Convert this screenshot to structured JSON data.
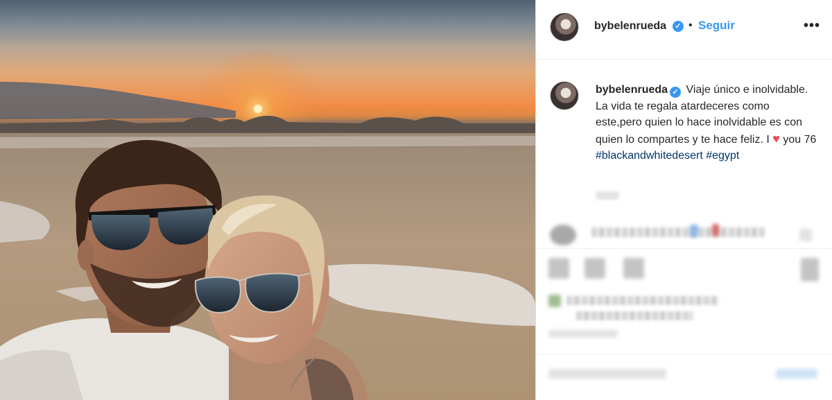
{
  "post": {
    "username": "bybelenrueda",
    "verified_mark": "✓",
    "separator": "•",
    "follow_label": "Seguir",
    "more_label": "•••",
    "caption": {
      "text_1": "Viaje único e inolvidable. La vida te regala atardeceres como este,pero quien lo hace inolvidable es con quien lo compartes y te hace feliz. I",
      "heart": "♥",
      "text_2": "you 76",
      "hashtags": [
        "#blackandwhitedesert",
        "#egypt"
      ]
    }
  },
  "icons": {
    "verified": "verified-badge-icon",
    "heart": "heart-emoji-icon",
    "more": "more-options-icon"
  },
  "colors": {
    "link_blue": "#3897f0",
    "hashtag_blue": "#003569",
    "heart_red": "#ed4956",
    "border": "#dbdbdb"
  }
}
